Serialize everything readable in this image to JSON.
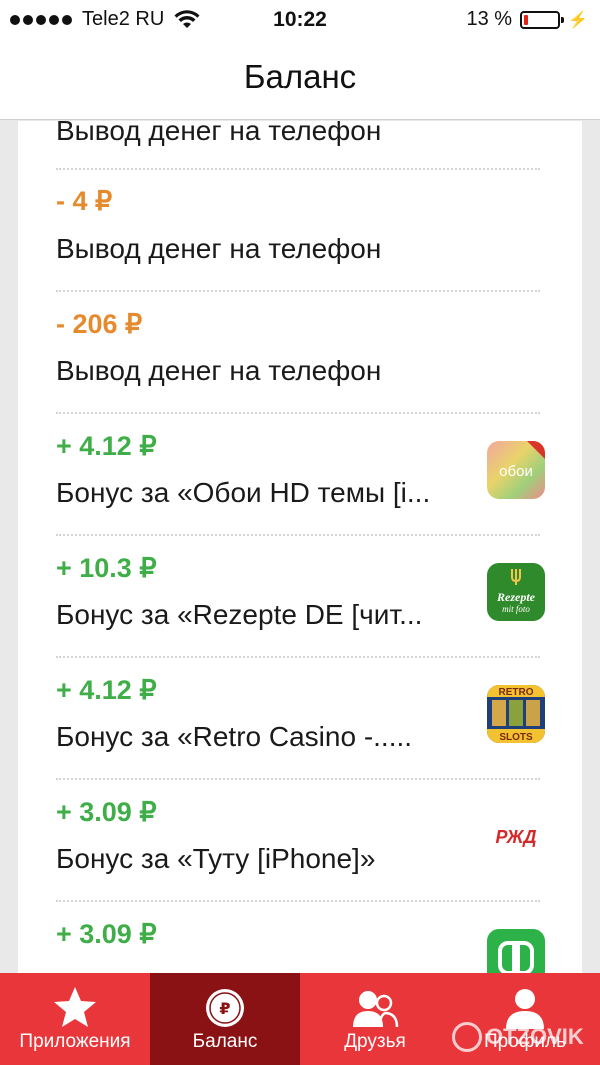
{
  "status_bar": {
    "carrier": "Tele2 RU",
    "time": "10:22",
    "battery": "13 %",
    "battery_level": 0.13,
    "signal_dots": 5
  },
  "nav": {
    "title": "Баланс"
  },
  "transactions": [
    {
      "amount": "",
      "description": "Вывод денег на телефон",
      "type": "negative"
    },
    {
      "amount": "- 4 ₽",
      "description": "Вывод денег на телефон",
      "type": "negative"
    },
    {
      "amount": "- 206 ₽",
      "description": "Вывод денег на телефон",
      "type": "negative"
    },
    {
      "amount": "+ 4.12 ₽",
      "description": "Бонус за «Обои HD темы [i...",
      "type": "positive",
      "icon": "oboi-app-icon",
      "icon_text": "обои"
    },
    {
      "amount": "+ 10.3 ₽",
      "description": "Бонус за «Rezepte DE [чит...",
      "type": "positive",
      "icon": "rezepte-app-icon",
      "icon_text": "Rezepte mit foto"
    },
    {
      "amount": "+ 4.12 ₽",
      "description": "Бонус за «Retro Casino -.....",
      "type": "positive",
      "icon": "retro-slots-app-icon",
      "icon_text": "RETRO SLOTS"
    },
    {
      "amount": "+ 3.09 ₽",
      "description": "Бонус за «Туту [iPhone]»",
      "type": "positive",
      "icon": "rzd-app-icon",
      "icon_text": "РЖД"
    },
    {
      "amount": "+ 3.09 ₽",
      "description": "",
      "type": "positive",
      "icon": "green-app-icon"
    }
  ],
  "tabs": [
    {
      "label": "Приложения",
      "icon": "star-icon",
      "active": false
    },
    {
      "label": "Баланс",
      "icon": "ruble-coin-icon",
      "active": true
    },
    {
      "label": "Друзья",
      "icon": "friends-icon",
      "active": false
    },
    {
      "label": "Профиль",
      "icon": "profile-icon",
      "active": false
    }
  ],
  "watermark": "OTZOVIK",
  "colors": {
    "negative": "#e68a2e",
    "positive": "#3fae49",
    "tab_bg": "#e8363b",
    "tab_active": "#8a1215"
  }
}
